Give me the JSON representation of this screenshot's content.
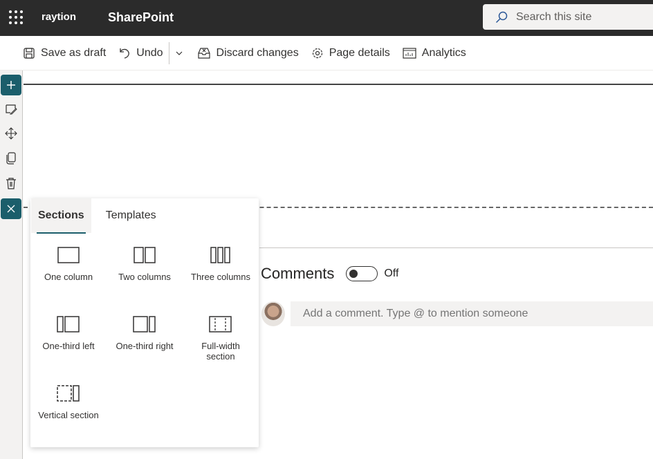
{
  "header": {
    "brand": "raytion",
    "app_name": "SharePoint",
    "search_placeholder": "Search this site"
  },
  "toolbar": {
    "save": "Save as draft",
    "undo": "Undo",
    "discard": "Discard changes",
    "details": "Page details",
    "analytics": "Analytics"
  },
  "comments": {
    "title": "Comments",
    "toggle_state": "Off",
    "placeholder": "Add a comment. Type @ to mention someone"
  },
  "panel": {
    "tabs": [
      "Sections",
      "Templates"
    ],
    "active_tab": "Sections",
    "options": [
      "One column",
      "Two columns",
      "Three columns",
      "One-third left",
      "One-third right",
      "Full-width section",
      "Vertical section"
    ]
  },
  "colors": {
    "accent": "#1b5e6b",
    "topbar": "#2b2b2b"
  }
}
